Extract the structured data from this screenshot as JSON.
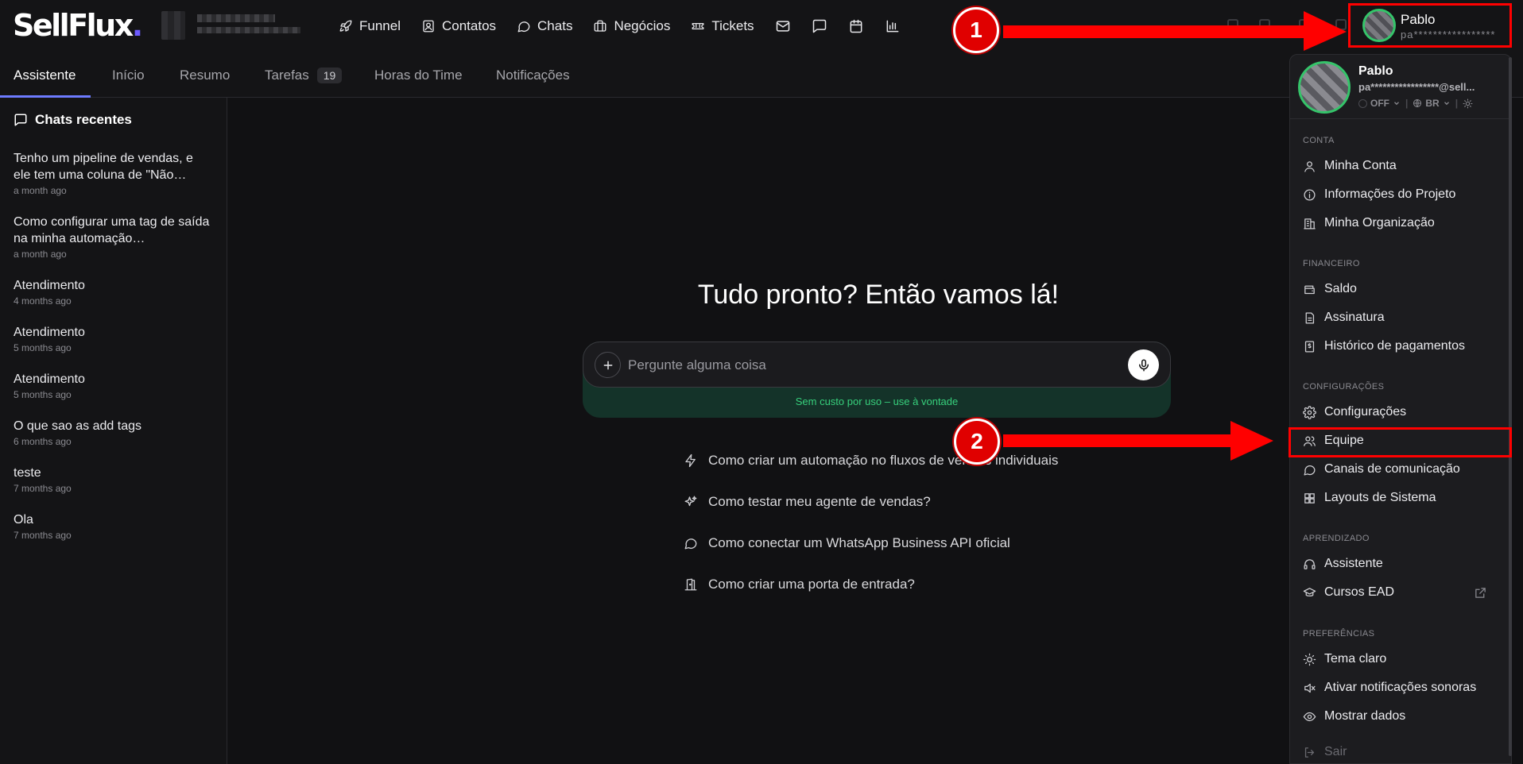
{
  "brand": {
    "logo_text": "SellFlux",
    "logo_dot": "."
  },
  "nav": {
    "items": [
      {
        "label": "Funnel",
        "icon": "rocket-icon"
      },
      {
        "label": "Contatos",
        "icon": "contact-card-icon"
      },
      {
        "label": "Chats",
        "icon": "chat-bubble-icon"
      },
      {
        "label": "Negócios",
        "icon": "briefcase-icon"
      },
      {
        "label": "Tickets",
        "icon": "ticket-icon"
      }
    ],
    "icon_buttons": [
      "mail-icon",
      "message-square-icon",
      "calendar-icon",
      "bar-chart-icon"
    ]
  },
  "user": {
    "name": "Pablo",
    "email_masked": "pa*****************"
  },
  "tabs": [
    {
      "label": "Assistente",
      "active": true
    },
    {
      "label": "Início"
    },
    {
      "label": "Resumo"
    },
    {
      "label": "Tarefas",
      "badge": "19"
    },
    {
      "label": "Horas do Time"
    },
    {
      "label": "Notificações"
    }
  ],
  "sidebar": {
    "title": "Chats recentes",
    "chats": [
      {
        "title": "Tenho um pipeline de vendas, e ele tem uma coluna de \"Não…",
        "time": "a month ago"
      },
      {
        "title": "Como configurar uma tag de saída na minha automação…",
        "time": "a month ago"
      },
      {
        "title": "Atendimento",
        "time": "4 months ago"
      },
      {
        "title": "Atendimento",
        "time": "5 months ago"
      },
      {
        "title": "Atendimento",
        "time": "5 months ago"
      },
      {
        "title": "O que sao as add tags",
        "time": "6 months ago"
      },
      {
        "title": "teste",
        "time": "7 months ago"
      },
      {
        "title": "Ola",
        "time": "7 months ago"
      }
    ]
  },
  "main": {
    "hero": "Tudo pronto? Então vamos lá!",
    "prompt_placeholder": "Pergunte alguma coisa",
    "free_note": "Sem custo por uso – use à vontade",
    "suggestions": [
      {
        "text": "Como criar um automação no fluxos de vendas individuais",
        "icon": "lightning-icon"
      },
      {
        "text": "Como testar meu agente de vendas?",
        "icon": "sparkles-icon"
      },
      {
        "text": "Como conectar um WhatsApp Business API oficial",
        "icon": "chat-circle-icon"
      },
      {
        "text": "Como criar uma porta de entrada?",
        "icon": "door-icon"
      }
    ]
  },
  "dropdown": {
    "name": "Pablo",
    "email_masked": "pa*****************@sell...",
    "status": "OFF",
    "language": "BR",
    "sections": [
      {
        "title": "CONTA",
        "items": [
          {
            "label": "Minha Conta",
            "icon": "user-icon"
          },
          {
            "label": "Informações do Projeto",
            "icon": "info-icon"
          },
          {
            "label": "Minha Organização",
            "icon": "building-icon"
          }
        ]
      },
      {
        "title": "FINANCEIRO",
        "items": [
          {
            "label": "Saldo",
            "icon": "wallet-icon"
          },
          {
            "label": "Assinatura",
            "icon": "document-icon"
          },
          {
            "label": "Histórico de pagamentos",
            "icon": "receipt-dollar-icon"
          }
        ]
      },
      {
        "title": "CONFIGURAÇÕES",
        "items": [
          {
            "label": "Configurações",
            "icon": "gear-icon"
          },
          {
            "label": "Equipe",
            "icon": "users-icon"
          },
          {
            "label": "Canais de comunicação",
            "icon": "chat-circle-icon"
          },
          {
            "label": "Layouts de Sistema",
            "icon": "layout-grid-icon"
          }
        ]
      },
      {
        "title": "APRENDIZADO",
        "items": [
          {
            "label": "Assistente",
            "icon": "headset-icon"
          },
          {
            "label": "Cursos EAD",
            "icon": "graduation-cap-icon"
          }
        ]
      },
      {
        "title": "PREFERÊNCIAS",
        "items": [
          {
            "label": "Tema claro",
            "icon": "sun-icon"
          },
          {
            "label": "Ativar notificações sonoras",
            "icon": "volume-mute-icon"
          },
          {
            "label": "Mostrar dados",
            "icon": "eye-icon"
          }
        ]
      }
    ],
    "logout": "Sair"
  },
  "annotations": {
    "step1": "1",
    "step2": "2",
    "highlight_color": "#ff0000"
  }
}
